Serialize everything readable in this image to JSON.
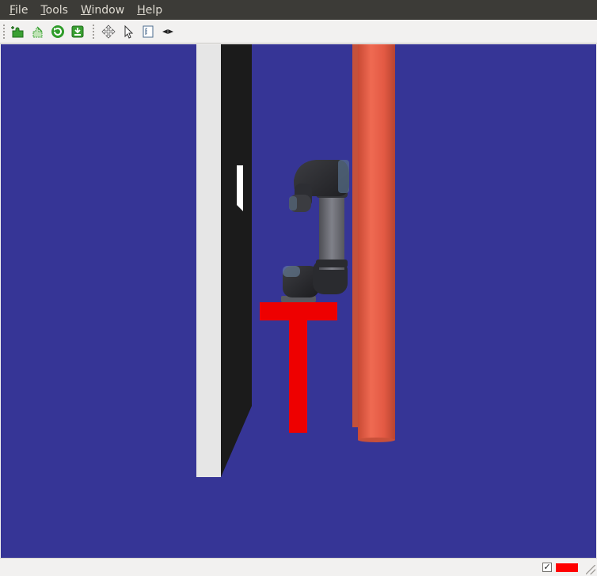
{
  "menubar": {
    "file": "File",
    "tools": "Tools",
    "window": "Window",
    "help": "Help"
  },
  "toolbar": {
    "icons": [
      "add-plugin-icon",
      "edit-plugins-icon",
      "reload-icon",
      "save-icon",
      "move-camera-icon",
      "select-icon",
      "measure-icon",
      "focus-camera-icon"
    ]
  },
  "viewport": {
    "background_color": "#363596",
    "scene": "robot-arm-3d-view"
  },
  "statusbar": {
    "checkbox_checked": "✓",
    "indicator_color": "#ff0000"
  }
}
